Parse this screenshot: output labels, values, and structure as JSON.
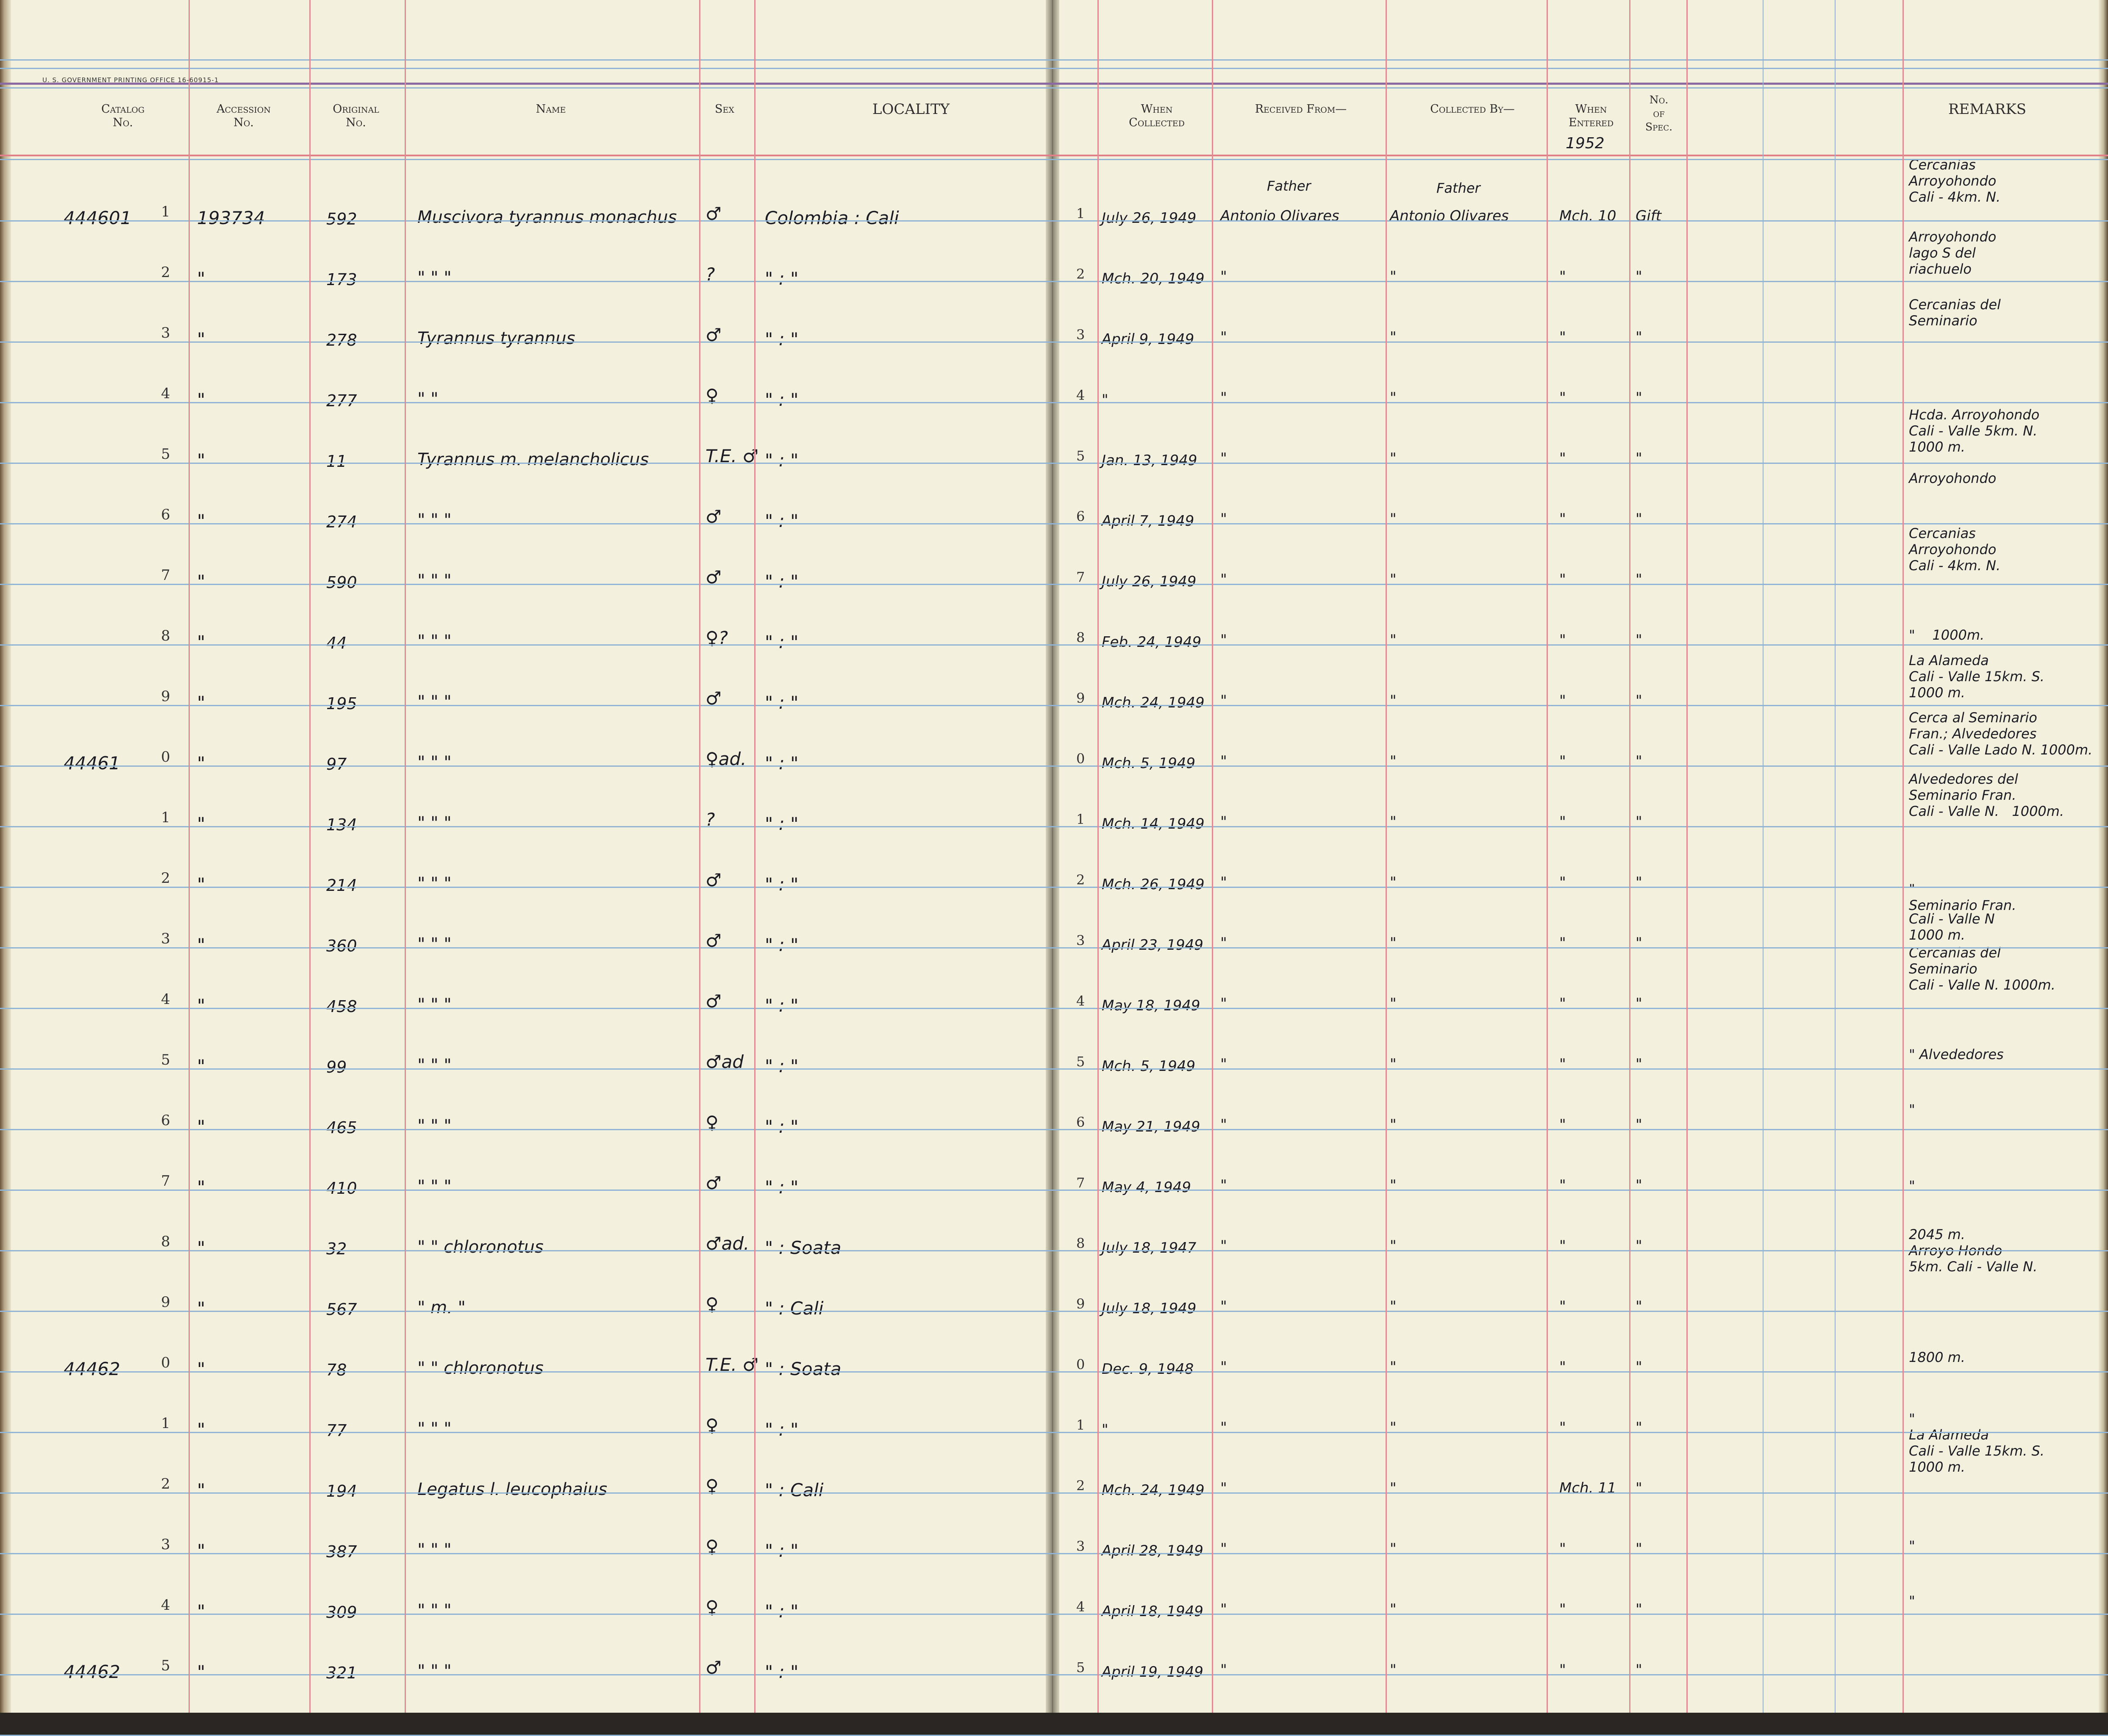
{
  "printer_line": "U. S. GOVERNMENT PRINTING OFFICE   16-60915-1",
  "left_headers": {
    "catalog": "Catalog\nNo.",
    "accession": "Accession\nNo.",
    "original": "Original\nNo.",
    "name": "Name",
    "sex": "Sex",
    "locality": "LOCALITY"
  },
  "right_headers": {
    "when_collected": "When\nCollected",
    "received_from": "Received From—",
    "collected_by": "Collected By—",
    "when_entered": "When\nEntered",
    "no_spec": "No.\nof\nSpec.",
    "remarks": "REMARKS"
  },
  "entered_year": "1952",
  "header_notes": {
    "received_title": "Father",
    "collected_title": "Father"
  },
  "rows": [
    {
      "catalog": "444601",
      "digit": "1",
      "accession": "193734",
      "original": "592",
      "name": "Muscivora tyrannus monachus",
      "sex": "♂",
      "locality": "Colombia : Cali",
      "row_no": "1",
      "date": "July 26, 1949",
      "received": "Antonio Olivares",
      "collected": "Antonio Olivares",
      "entered": "Mch. 10",
      "spec": "Gift"
    },
    {
      "catalog": "",
      "digit": "2",
      "accession": "\"",
      "original": "173",
      "name": "\"       \"       \"",
      "sex": "?",
      "locality": "\"   :   \"",
      "row_no": "2",
      "date": "Mch. 20, 1949",
      "received": "\"",
      "collected": "\"",
      "entered": "\"",
      "spec": "\""
    },
    {
      "catalog": "",
      "digit": "3",
      "accession": "\"",
      "original": "278",
      "name": "Tyrannus tyrannus",
      "sex": "♂",
      "locality": "\"   :   \"",
      "row_no": "3",
      "date": "April 9, 1949",
      "received": "\"",
      "collected": "\"",
      "entered": "\"",
      "spec": "\""
    },
    {
      "catalog": "",
      "digit": "4",
      "accession": "\"",
      "original": "277",
      "name": "\"       \"",
      "sex": "♀",
      "locality": "\"   :   \"",
      "row_no": "4",
      "date": "\"",
      "received": "\"",
      "collected": "\"",
      "entered": "\"",
      "spec": "\""
    },
    {
      "catalog": "",
      "digit": "5",
      "accession": "\"",
      "original": "11",
      "name": "Tyrannus m. melancholicus",
      "sex": "T.E. ♂",
      "locality": "\"   :   \"",
      "row_no": "5",
      "date": "Jan. 13, 1949",
      "received": "\"",
      "collected": "\"",
      "entered": "\"",
      "spec": "\""
    },
    {
      "catalog": "",
      "digit": "6",
      "accession": "\"",
      "original": "274",
      "name": "\"    \"    \"",
      "sex": "♂",
      "locality": "\"   :   \"",
      "row_no": "6",
      "date": "April 7, 1949",
      "received": "\"",
      "collected": "\"",
      "entered": "\"",
      "spec": "\""
    },
    {
      "catalog": "",
      "digit": "7",
      "accession": "\"",
      "original": "590",
      "name": "\"    \"    \"",
      "sex": "♂",
      "locality": "\"   :   \"",
      "row_no": "7",
      "date": "July 26, 1949",
      "received": "\"",
      "collected": "\"",
      "entered": "\"",
      "spec": "\""
    },
    {
      "catalog": "",
      "digit": "8",
      "accession": "\"",
      "original": "44",
      "name": "\"    \"    \"",
      "sex": "♀?",
      "locality": "\"   :   \"",
      "row_no": "8",
      "date": "Feb. 24, 1949",
      "received": "\"",
      "collected": "\"",
      "entered": "\"",
      "spec": "\""
    },
    {
      "catalog": "",
      "digit": "9",
      "accession": "\"",
      "original": "195",
      "name": "\"    \"    \"",
      "sex": "♂",
      "locality": "\"   :   \"",
      "row_no": "9",
      "date": "Mch. 24, 1949",
      "received": "\"",
      "collected": "\"",
      "entered": "\"",
      "spec": "\""
    },
    {
      "catalog": "44461",
      "digit": "0",
      "accession": "\"",
      "original": "97",
      "name": "\"    \"    \"",
      "sex": "♀ad.",
      "locality": "\"   :   \"",
      "row_no": "0",
      "date": "Mch. 5, 1949",
      "received": "\"",
      "collected": "\"",
      "entered": "\"",
      "spec": "\""
    },
    {
      "catalog": "",
      "digit": "1",
      "accession": "\"",
      "original": "134",
      "name": "\"    \"    \"",
      "sex": "?",
      "locality": "\"   :   \"",
      "row_no": "1",
      "date": "Mch. 14, 1949",
      "received": "\"",
      "collected": "\"",
      "entered": "\"",
      "spec": "\""
    },
    {
      "catalog": "",
      "digit": "2",
      "accession": "\"",
      "original": "214",
      "name": "\"    \"    \"",
      "sex": "♂",
      "locality": "\"   :   \"",
      "row_no": "2",
      "date": "Mch. 26, 1949",
      "received": "\"",
      "collected": "\"",
      "entered": "\"",
      "spec": "\""
    },
    {
      "catalog": "",
      "digit": "3",
      "accession": "\"",
      "original": "360",
      "name": "\"    \"    \"",
      "sex": "♂",
      "locality": "\"   :   \"",
      "row_no": "3",
      "date": "April 23, 1949",
      "received": "\"",
      "collected": "\"",
      "entered": "\"",
      "spec": "\""
    },
    {
      "catalog": "",
      "digit": "4",
      "accession": "\"",
      "original": "458",
      "name": "\"    \"    \"",
      "sex": "♂",
      "locality": "\"   :   \"",
      "row_no": "4",
      "date": "May 18, 1949",
      "received": "\"",
      "collected": "\"",
      "entered": "\"",
      "spec": "\""
    },
    {
      "catalog": "",
      "digit": "5",
      "accession": "\"",
      "original": "99",
      "name": "\"    \"    \"",
      "sex": "♂ad",
      "locality": "\"   :   \"",
      "row_no": "5",
      "date": "Mch. 5, 1949",
      "received": "\"",
      "collected": "\"",
      "entered": "\"",
      "spec": "\""
    },
    {
      "catalog": "",
      "digit": "6",
      "accession": "\"",
      "original": "465",
      "name": "\"    \"    \"",
      "sex": "♀",
      "locality": "\"   :   \"",
      "row_no": "6",
      "date": "May 21, 1949",
      "received": "\"",
      "collected": "\"",
      "entered": "\"",
      "spec": "\""
    },
    {
      "catalog": "",
      "digit": "7",
      "accession": "\"",
      "original": "410",
      "name": "\"    \"    \"",
      "sex": "♂",
      "locality": "\"   :   \"",
      "row_no": "7",
      "date": "May 4, 1949",
      "received": "\"",
      "collected": "\"",
      "entered": "\"",
      "spec": "\""
    },
    {
      "catalog": "",
      "digit": "8",
      "accession": "\"",
      "original": "32",
      "name": "\"     \" chloronotus",
      "sex": "♂ad.",
      "locality": "\"  :  Soata",
      "row_no": "8",
      "date": "July 18, 1947",
      "received": "\"",
      "collected": "\"",
      "entered": "\"",
      "spec": "\""
    },
    {
      "catalog": "",
      "digit": "9",
      "accession": "\"",
      "original": "567",
      "name": "\"   m.   \"",
      "sex": "♀",
      "locality": "\"  :  Cali",
      "row_no": "9",
      "date": "July 18, 1949",
      "received": "\"",
      "collected": "\"",
      "entered": "\"",
      "spec": "\""
    },
    {
      "catalog": "44462",
      "digit": "0",
      "accession": "\"",
      "original": "78",
      "name": "\"     \" chloronotus",
      "sex": "T.E. ♂",
      "locality": "\"  :  Soata",
      "row_no": "0",
      "date": "Dec. 9, 1948",
      "received": "\"",
      "collected": "\"",
      "entered": "\"",
      "spec": "\""
    },
    {
      "catalog": "",
      "digit": "1",
      "accession": "\"",
      "original": "77",
      "name": "\"    \"    \"",
      "sex": "♀",
      "locality": "\"   :   \"",
      "row_no": "1",
      "date": "\"",
      "received": "\"",
      "collected": "\"",
      "entered": "\"",
      "spec": "\""
    },
    {
      "catalog": "",
      "digit": "2",
      "accession": "\"",
      "original": "194",
      "name": "Legatus l. leucophaius",
      "sex": "♀",
      "locality": "\"  :  Cali",
      "row_no": "2",
      "date": "Mch. 24, 1949",
      "received": "\"",
      "collected": "\"",
      "entered": "Mch. 11",
      "spec": "\""
    },
    {
      "catalog": "",
      "digit": "3",
      "accession": "\"",
      "original": "387",
      "name": "\"    \"    \"",
      "sex": "♀",
      "locality": "\"   :   \"",
      "row_no": "3",
      "date": "April 28, 1949",
      "received": "\"",
      "collected": "\"",
      "entered": "\"",
      "spec": "\""
    },
    {
      "catalog": "",
      "digit": "4",
      "accession": "\"",
      "original": "309",
      "name": "\"    \"    \"",
      "sex": "♀",
      "locality": "\"   :   \"",
      "row_no": "4",
      "date": "April 18, 1949",
      "received": "\"",
      "collected": "\"",
      "entered": "\"",
      "spec": "\""
    },
    {
      "catalog": "44462",
      "digit": "5",
      "accession": "\"",
      "original": "321",
      "name": "\"    \"    \"",
      "sex": "♂",
      "locality": "\"   :   \"",
      "row_no": "5",
      "date": "April 19, 1949",
      "received": "\"",
      "collected": "\"",
      "entered": "\"",
      "spec": "\""
    }
  ],
  "remarks": [
    "Cercanias\nArroyohondo\nCali - 4km. N.",
    "Arroyohondo\nlago S del\nriachuelo",
    "Cercanias del\nSeminario",
    "Hcda. Arroyohondo\nCali - Valle 5km. N.\n1000 m.",
    "Arroyohondo",
    "Cercanias\nArroyohondo\nCali - 4km. N.",
    "\"    1000m.",
    "La Alameda\nCali - Valle 15km. S.\n1000 m.",
    "Cerca al Seminario\nFran.; Alvededores\nCali - Valle Lado N. 1000m.",
    "Alvededores del\nSeminario Fran.\nCali - Valle N.   1000m.",
    "\"\nSeminario Fran.",
    "Cali - Valle N\n1000 m.",
    "Cercanias del\nSeminario\nCali - Valle N. 1000m.",
    "\" Alvededores",
    "\"",
    "\"",
    "2045 m.\nArroyo Hondo\n5km. Cali - Valle N.",
    "1800 m.",
    "\"\nLa Alameda\nCali - Valle 15km. S.\n1000 m.",
    "\"",
    "\""
  ]
}
